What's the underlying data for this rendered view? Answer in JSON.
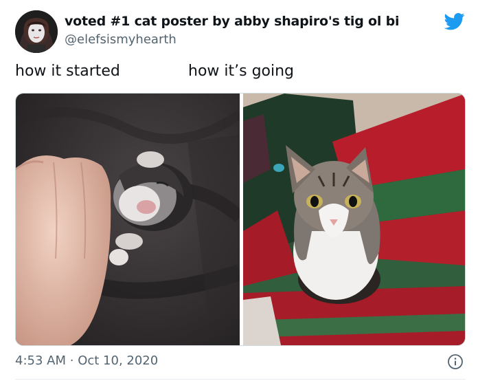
{
  "tweet": {
    "display_name": "voted #1 cat poster by abby shapiro's tig ol bi",
    "handle": "@elefsismyhearth",
    "caption_left": "how it started",
    "caption_right": "how it’s going",
    "time": "4:53 AM",
    "separator": "·",
    "date": "Oct 10, 2020"
  },
  "icons": {
    "brand": "twitter-bird-icon",
    "info": "info-icon",
    "brand_color": "#1d9bf0"
  },
  "media": {
    "panels": [
      "kitten-photo",
      "cat-photo"
    ]
  }
}
